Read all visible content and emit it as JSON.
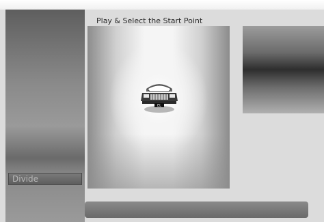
{
  "header": {
    "title": "Play & Select the Start Point"
  },
  "sidebar": {
    "divide_label": "Divide"
  },
  "video": {
    "car_plate": "EL"
  }
}
